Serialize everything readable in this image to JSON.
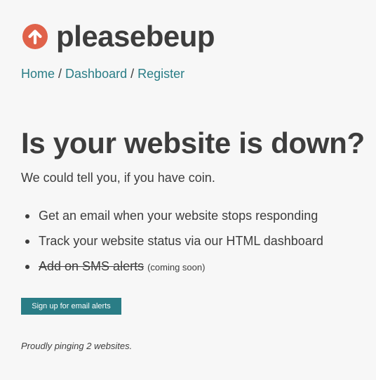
{
  "header": {
    "logo_icon": "arrow-up-circle-icon",
    "brand": "pleasebeup"
  },
  "breadcrumb": {
    "home": "Home",
    "separator": "/",
    "dashboard": "Dashboard",
    "register": "Register"
  },
  "main": {
    "headline": "Is your website is down?",
    "tagline": "We could tell you, if you have coin.",
    "features": [
      {
        "text": "Get an email when your website stops responding"
      },
      {
        "text": "Track your website status via our HTML dashboard"
      },
      {
        "text": "Add on SMS alerts",
        "note": "(coming soon)"
      }
    ],
    "cta_label": "Sign up for email alerts",
    "footer_note": "Proudly pinging 2 websites."
  },
  "colors": {
    "accent": "#2a7d86",
    "logo": "#e0624a",
    "text": "#3d3d3d",
    "background": "#f7f7f7"
  }
}
